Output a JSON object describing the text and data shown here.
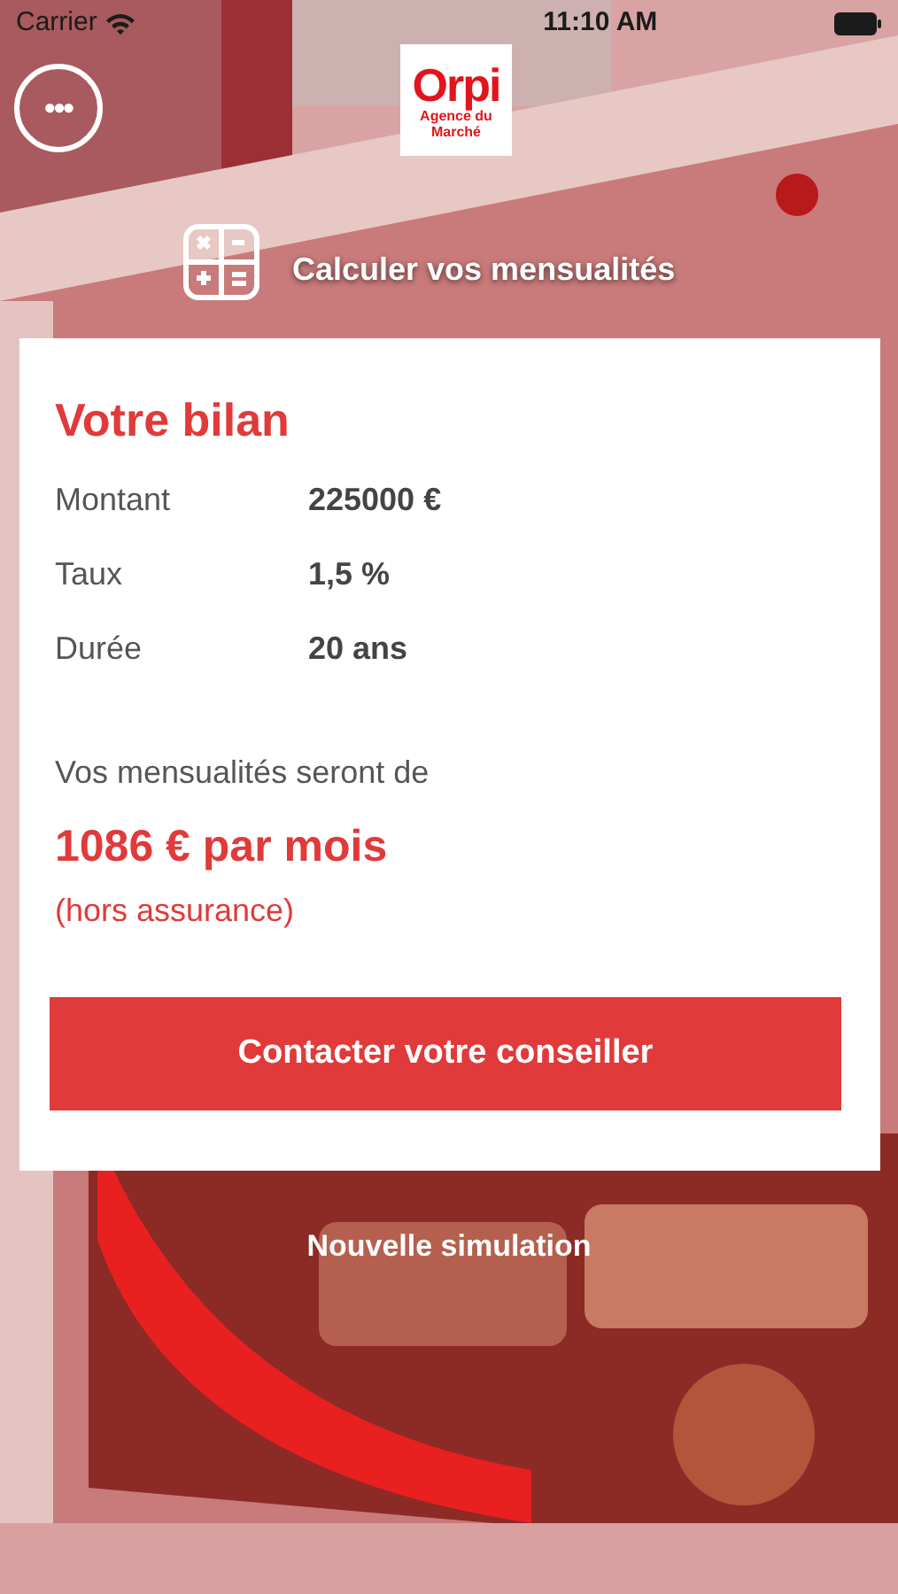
{
  "status_bar": {
    "carrier": "Carrier",
    "time": "11:10 AM"
  },
  "header": {
    "menu_button": "•••",
    "logo": {
      "brand": "Orpi",
      "agency": [
        "Agence du",
        "Marché"
      ]
    },
    "title": "Calculer vos mensualités"
  },
  "result_card": {
    "title": "Votre bilan",
    "rows": [
      {
        "label": "Montant",
        "value": "225000 €"
      },
      {
        "label": "Taux",
        "value": "1,5 %"
      },
      {
        "label": "Durée",
        "value": "20 ans"
      }
    ],
    "intro": "Vos mensualités seront de",
    "amount": "1086 € par mois",
    "note": "(hors assurance)",
    "button": "Contacter votre conseiller"
  },
  "link": "Nouvelle simulation"
}
